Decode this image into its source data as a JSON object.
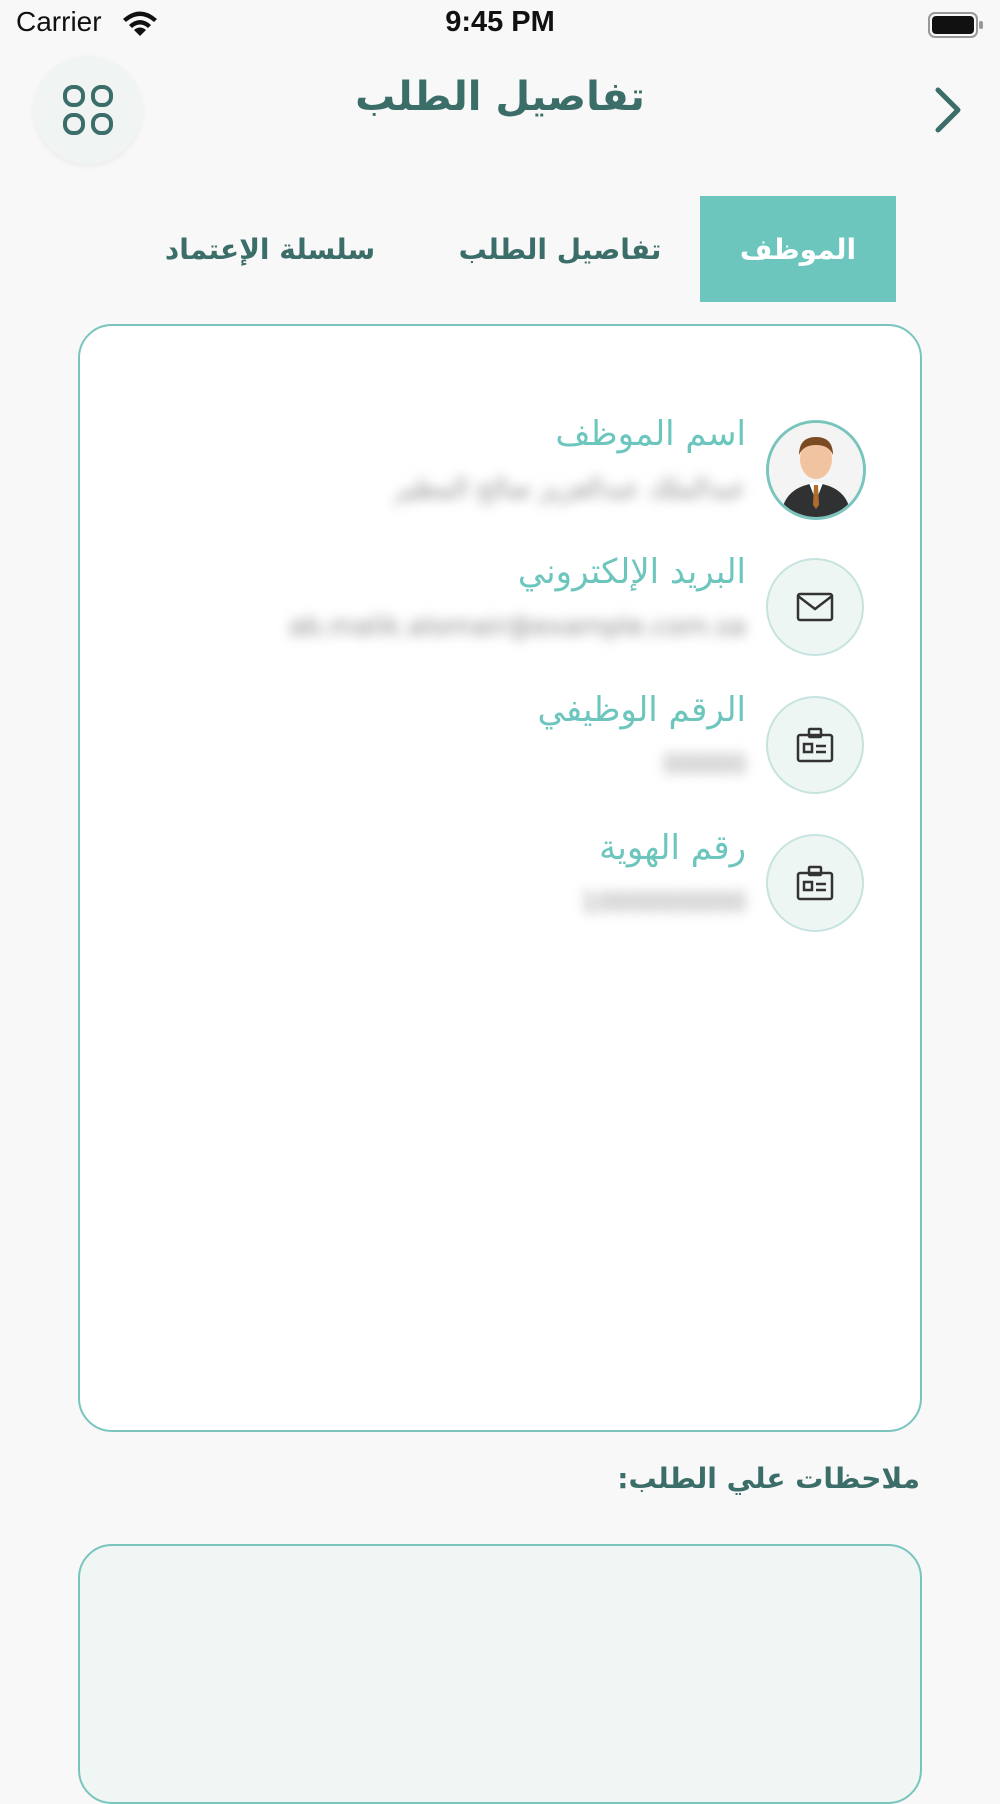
{
  "status_bar": {
    "carrier": "Carrier",
    "time": "9:45 PM"
  },
  "header": {
    "title": "تفاصيل الطلب",
    "menu_icon": "grid-icon",
    "back_icon": "chevron-right-icon"
  },
  "tabs": [
    {
      "label": "الموظف",
      "active": true
    },
    {
      "label": "تفاصيل الطلب",
      "active": false
    },
    {
      "label": "سلسلة الإعتماد",
      "active": false
    }
  ],
  "employee": {
    "name": {
      "label": "اسم الموظف",
      "value": "عبدالملك عبدالعزيز صالح المطير"
    },
    "email": {
      "label": "البريد الإلكتروني",
      "value": "ab.malik.alomair@example.com.sa"
    },
    "employee_number": {
      "label": "الرقم الوظيفي",
      "value": "00000"
    },
    "id_number": {
      "label": "رقم الهوية",
      "value": "1000000000"
    }
  },
  "notes": {
    "label": "ملاحظات علي الطلب:",
    "value": ""
  },
  "colors": {
    "accent": "#6dc6bd",
    "title": "#3b6e69",
    "border": "#79c5bd",
    "background": "#f8f8f8"
  }
}
